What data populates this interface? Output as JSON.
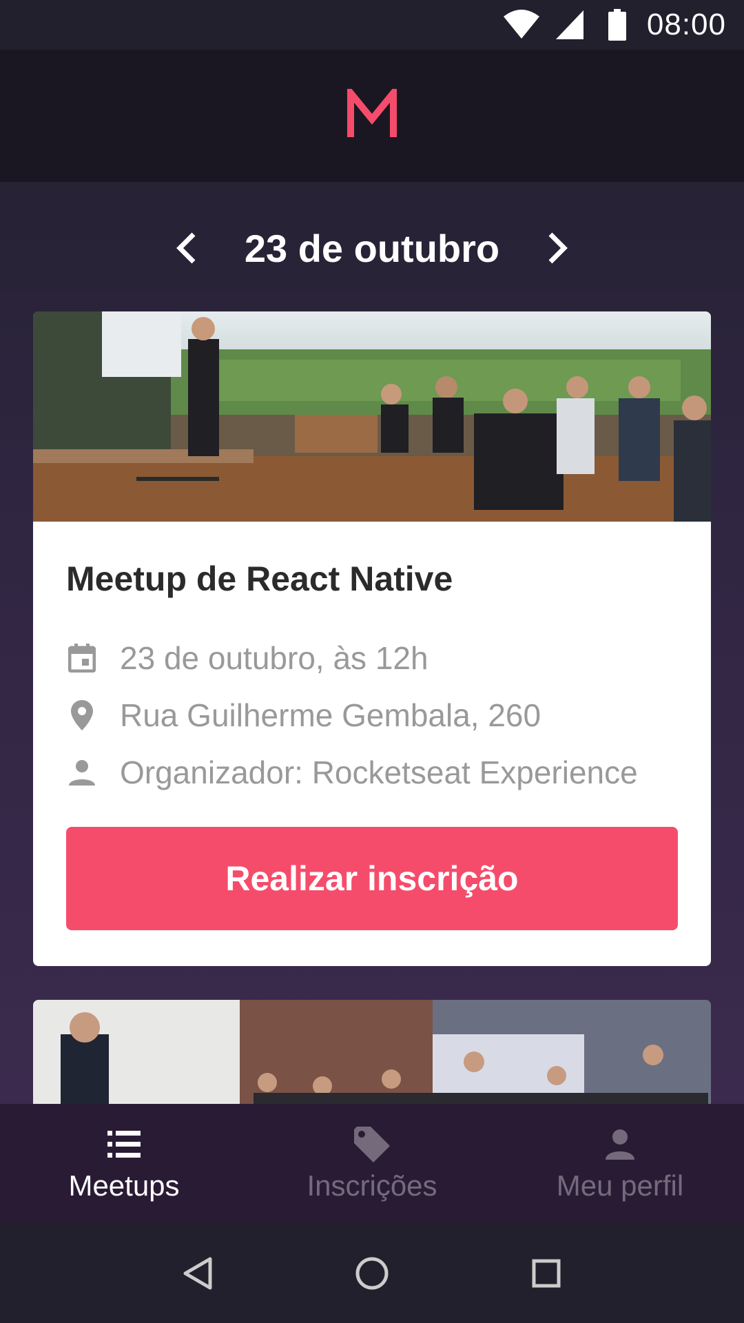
{
  "status_bar": {
    "time": "08:00",
    "icons": [
      "wifi-icon",
      "signal-icon",
      "battery-icon"
    ]
  },
  "header": {
    "logo_letter": "M",
    "logo_color": "#f64c6b"
  },
  "date_nav": {
    "title": "23 de outubro",
    "prev_icon": "chevron-left-icon",
    "next_icon": "chevron-right-icon"
  },
  "meetups": [
    {
      "title": "Meetup de React Native",
      "date": "23 de outubro, às 12h",
      "address": "Rua Guilherme Gembala, 260",
      "organizer": "Organizador: Rocketseat Experience",
      "button_label": "Realizar inscrição",
      "icons": [
        "calendar-icon",
        "location-pin-icon",
        "person-icon"
      ]
    }
  ],
  "tabs": [
    {
      "label": "Meetups",
      "icon": "list-icon",
      "active": true
    },
    {
      "label": "Inscrições",
      "icon": "tag-icon",
      "active": false
    },
    {
      "label": "Meu perfil",
      "icon": "person-icon",
      "active": false
    }
  ],
  "colors": {
    "accent": "#f64c6b",
    "background_top": "#22202c",
    "background_bottom": "#402c52",
    "tab_bar": "#2a1b35"
  }
}
